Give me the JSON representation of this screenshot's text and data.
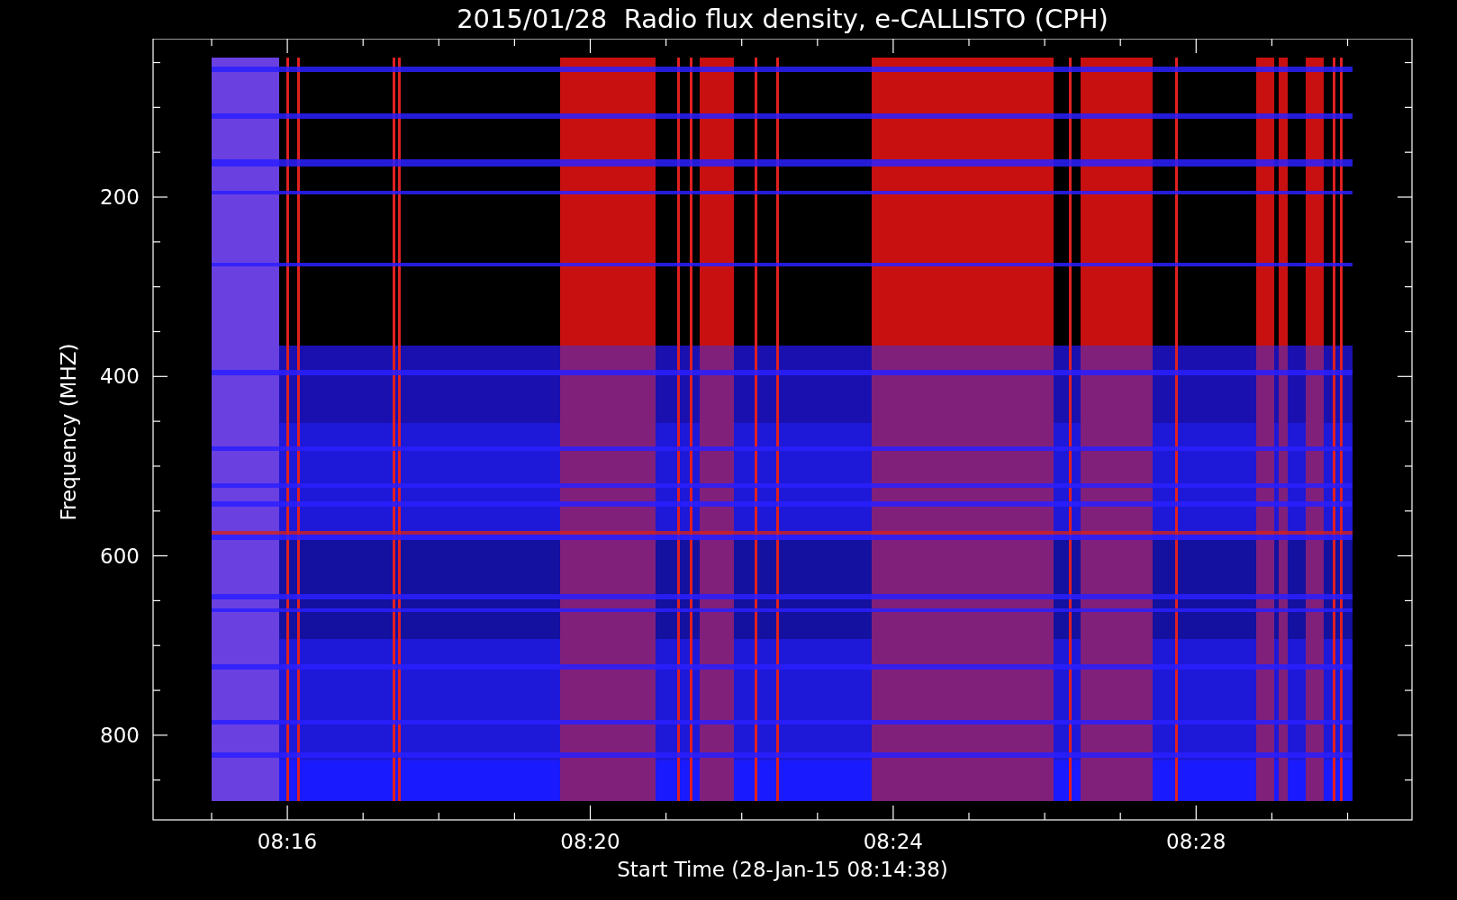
{
  "title": "2015/01/28  Radio flux density, e-CALLISTO (CPH)",
  "y_axis": {
    "label": "Frequency (MHZ)",
    "ticks": [
      "200",
      "400",
      "600",
      "800"
    ]
  },
  "x_axis": {
    "label": "Start Time (28-Jan-15 08:14:38)",
    "ticks": [
      "08:16",
      "08:20",
      "08:24",
      "08:28"
    ]
  }
}
